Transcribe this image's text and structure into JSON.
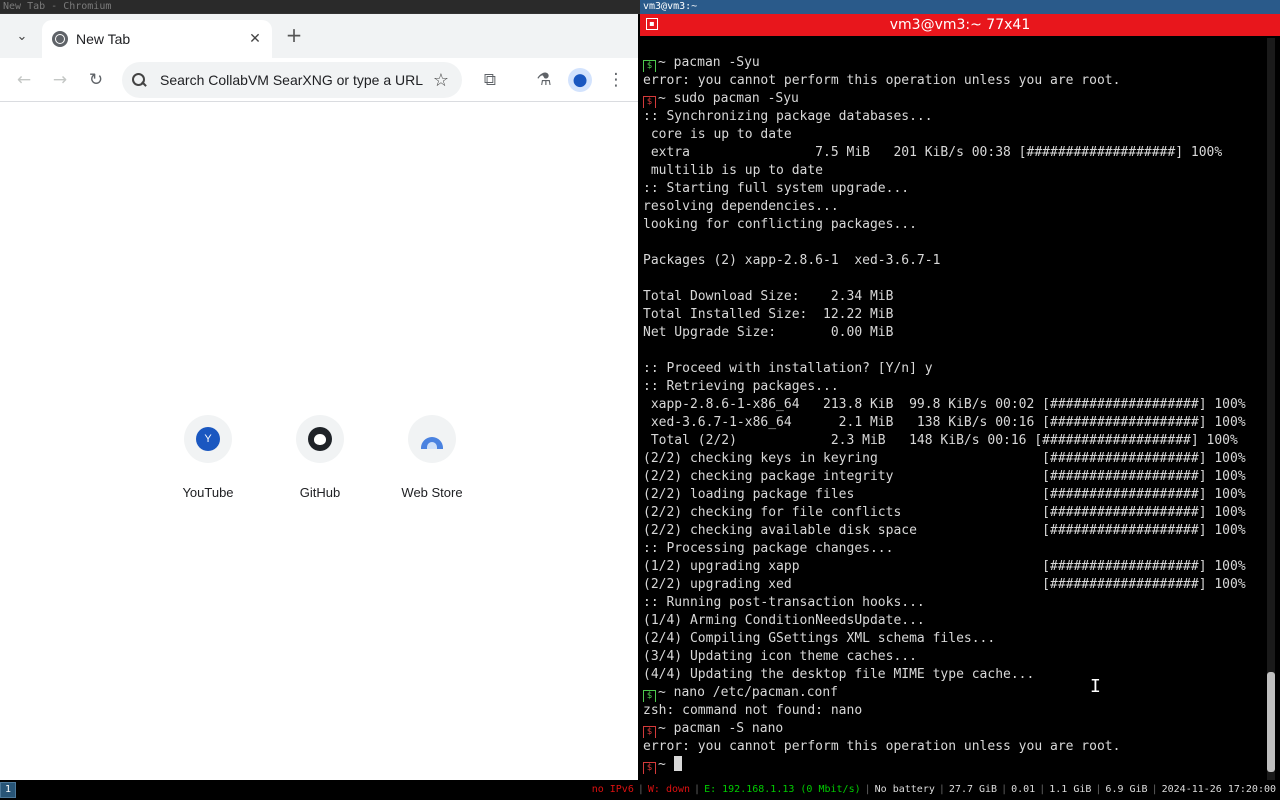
{
  "window_titles": {
    "left": "New Tab - Chromium",
    "right": "vm3@vm3:~"
  },
  "browser": {
    "tab": {
      "title": "New Tab"
    },
    "omnibox": {
      "placeholder": "Search CollabVM SearXNG or type a URL"
    },
    "shortcuts": [
      {
        "label": "YouTube",
        "icon_letter": "Y"
      },
      {
        "label": "GitHub"
      },
      {
        "label": "Web Store"
      }
    ],
    "icons": {
      "tab_list": "chevron-down-icon",
      "close": "close-icon",
      "new_tab": "plus-icon",
      "back": "arrow-left-icon",
      "forward": "arrow-right-icon",
      "reload": "reload-icon",
      "bookmark": "star-icon",
      "extensions": "puzzle-icon",
      "labs": "flask-icon",
      "profile": "person-icon",
      "menu": "kebab-icon"
    }
  },
  "terminal": {
    "title": "vm3@vm3:~ 77x41",
    "lines": [
      {
        "p": "ok",
        "t": "~ pacman -Syu"
      },
      {
        "t": "error: you cannot perform this operation unless you are root."
      },
      {
        "p": "err",
        "t": "~ sudo pacman -Syu"
      },
      {
        "t": ":: Synchronizing package databases..."
      },
      {
        "t": " core is up to date"
      },
      {
        "t": " extra                7.5 MiB   201 KiB/s 00:38 [###################] 100%"
      },
      {
        "t": " multilib is up to date"
      },
      {
        "t": ":: Starting full system upgrade..."
      },
      {
        "t": "resolving dependencies..."
      },
      {
        "t": "looking for conflicting packages..."
      },
      {
        "t": ""
      },
      {
        "t": "Packages (2) xapp-2.8.6-1  xed-3.6.7-1"
      },
      {
        "t": ""
      },
      {
        "t": "Total Download Size:    2.34 MiB"
      },
      {
        "t": "Total Installed Size:  12.22 MiB"
      },
      {
        "t": "Net Upgrade Size:       0.00 MiB"
      },
      {
        "t": ""
      },
      {
        "t": ":: Proceed with installation? [Y/n] y"
      },
      {
        "t": ":: Retrieving packages..."
      },
      {
        "t": " xapp-2.8.6-1-x86_64   213.8 KiB  99.8 KiB/s 00:02 [###################] 100%"
      },
      {
        "t": " xed-3.6.7-1-x86_64      2.1 MiB   138 KiB/s 00:16 [###################] 100%"
      },
      {
        "t": " Total (2/2)            2.3 MiB   148 KiB/s 00:16 [###################] 100%"
      },
      {
        "t": "(2/2) checking keys in keyring                     [###################] 100%"
      },
      {
        "t": "(2/2) checking package integrity                   [###################] 100%"
      },
      {
        "t": "(2/2) loading package files                        [###################] 100%"
      },
      {
        "t": "(2/2) checking for file conflicts                  [###################] 100%"
      },
      {
        "t": "(2/2) checking available disk space                [###################] 100%"
      },
      {
        "t": ":: Processing package changes..."
      },
      {
        "t": "(1/2) upgrading xapp                               [###################] 100%"
      },
      {
        "t": "(2/2) upgrading xed                                [###################] 100%"
      },
      {
        "t": ":: Running post-transaction hooks..."
      },
      {
        "t": "(1/4) Arming ConditionNeedsUpdate..."
      },
      {
        "t": "(2/4) Compiling GSettings XML schema files..."
      },
      {
        "t": "(3/4) Updating icon theme caches..."
      },
      {
        "t": "(4/4) Updating the desktop file MIME type cache..."
      },
      {
        "p": "ok",
        "t": "~ nano /etc/pacman.conf"
      },
      {
        "t": "zsh: command not found: nano"
      },
      {
        "p": "err",
        "t": "~ pacman -S nano"
      },
      {
        "t": "error: you cannot perform this operation unless you are root."
      },
      {
        "p": "err",
        "t": "~ ",
        "cursor": true
      }
    ]
  },
  "i3bar": {
    "workspace": "1",
    "status": [
      {
        "text": "no IPv6",
        "color": "red"
      },
      {
        "text": "W: down",
        "color": "red"
      },
      {
        "text": "E: 192.168.1.13 (0 Mbit/s)",
        "color": "green"
      },
      {
        "text": "No battery",
        "color": "white"
      },
      {
        "text": "27.7 GiB",
        "color": "white"
      },
      {
        "text": "0.01",
        "color": "white"
      },
      {
        "text": "1.1 GiB",
        "color": "white"
      },
      {
        "text": "6.9 GiB",
        "color": "white"
      },
      {
        "text": "2024-11-26 17:20:00",
        "color": "white"
      }
    ]
  }
}
